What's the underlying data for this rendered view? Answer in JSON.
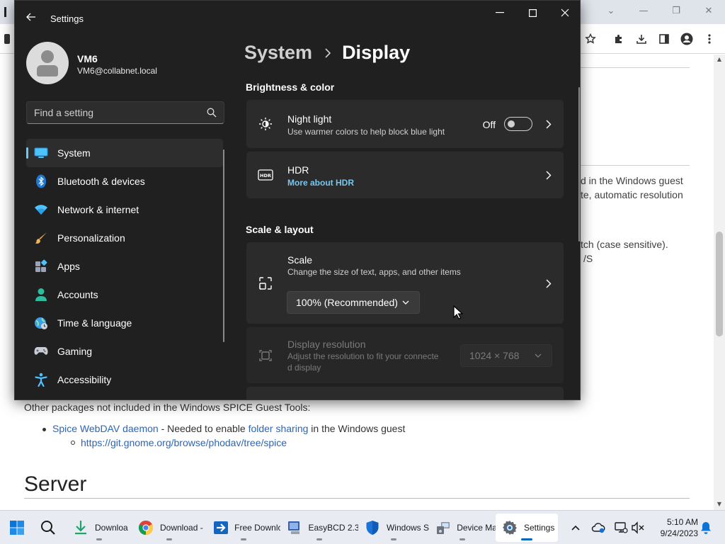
{
  "browser": {
    "page_fragments": [
      "d in the Windows guest",
      "te, automatic resolution",
      "tch (case sensitive).",
      "/S"
    ],
    "other_packages_text": "Other packages not included in the Windows SPICE Guest Tools:",
    "list_item": {
      "link": "Spice WebDAV daemon",
      "text_middle": " - Needed to enable ",
      "link2": "folder sharing",
      "text_end": " in the Windows guest"
    },
    "sub_link": "https://git.gnome.org/browse/phodav/tree/spice",
    "heading": "Server"
  },
  "settings": {
    "window_title": "Settings",
    "user": {
      "name": "VM6",
      "email": "VM6@collabnet.local"
    },
    "search": {
      "placeholder": "Find a setting"
    },
    "nav": [
      {
        "label": "System",
        "icon": "system-icon",
        "selected": true
      },
      {
        "label": "Bluetooth & devices",
        "icon": "bluetooth-icon",
        "selected": false
      },
      {
        "label": "Network & internet",
        "icon": "wifi-icon",
        "selected": false
      },
      {
        "label": "Personalization",
        "icon": "brush-icon",
        "selected": false
      },
      {
        "label": "Apps",
        "icon": "apps-icon",
        "selected": false
      },
      {
        "label": "Accounts",
        "icon": "person-icon",
        "selected": false
      },
      {
        "label": "Time & language",
        "icon": "globe-clock-icon",
        "selected": false
      },
      {
        "label": "Gaming",
        "icon": "gamepad-icon",
        "selected": false
      },
      {
        "label": "Accessibility",
        "icon": "accessibility-icon",
        "selected": false
      }
    ],
    "breadcrumb": {
      "parent": "System",
      "current": "Display"
    },
    "brightness_section": "Brightness & color",
    "night_light": {
      "title": "Night light",
      "subtitle": "Use warmer colors to help block blue light",
      "state": "Off"
    },
    "hdr": {
      "title": "HDR",
      "link": "More about HDR"
    },
    "scale_section": "Scale & layout",
    "scale": {
      "title": "Scale",
      "subtitle": "Change the size of text, apps, and other items",
      "value": "100% (Recommended)"
    },
    "resolution": {
      "title": "Display resolution",
      "subtitle_line1": "Adjust the resolution to fit your connecte",
      "subtitle_line2": "d display",
      "value": "1024 × 768"
    }
  },
  "taskbar": {
    "apps": [
      {
        "label": "Downloa",
        "icon": "download-arrow-icon"
      },
      {
        "label": "Download -",
        "icon": "chrome-icon"
      },
      {
        "label": "Free Downlc",
        "icon": "installer-icon"
      },
      {
        "label": "EasyBCD 2.3",
        "icon": "easybcd-icon"
      },
      {
        "label": "Windows S",
        "icon": "windows-security-icon"
      },
      {
        "label": "Device Ma",
        "icon": "device-manager-icon"
      },
      {
        "label": "Settings",
        "icon": "settings-gear-icon"
      }
    ],
    "clock": {
      "time": "5:10 AM",
      "date": "9/24/2023"
    }
  },
  "colors": {
    "accent": "#60cdff",
    "window_bg": "#202020",
    "card_bg": "#2b2b2b",
    "link": "#79c7ee"
  }
}
